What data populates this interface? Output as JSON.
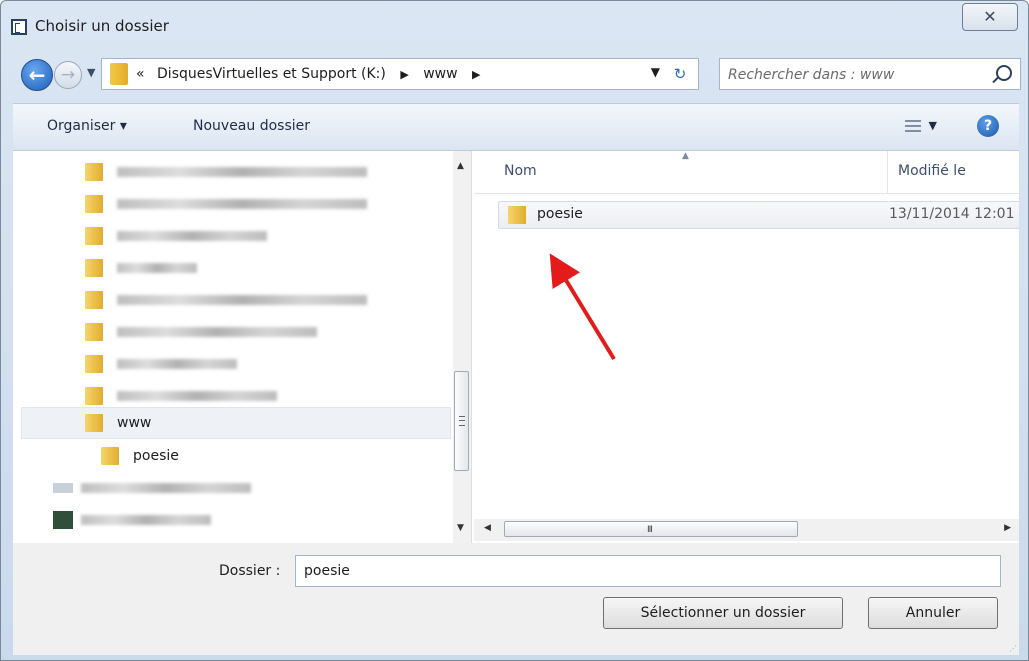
{
  "window": {
    "title": "Choisir un dossier",
    "close_symbol": "✕"
  },
  "address": {
    "chevron": "«",
    "crumbs": [
      "DisquesVirtuelles et Support (K:)",
      "www"
    ]
  },
  "search": {
    "placeholder": "Rechercher dans : www"
  },
  "toolbar": {
    "organise_label": "Organiser ▾",
    "new_folder_label": "Nouveau dossier"
  },
  "tree": {
    "selected_label": "www",
    "child_label": "poesie"
  },
  "file_list": {
    "columns": [
      "Nom",
      "Modifié le"
    ],
    "rows": [
      {
        "name": "poesie",
        "modified": "13/11/2014 12:01"
      }
    ]
  },
  "scroll": {
    "h_grip": "III"
  },
  "bottom": {
    "folder_label": "Dossier :",
    "folder_value": "poesie",
    "select_button": "Sélectionner un dossier",
    "cancel_button": "Annuler"
  },
  "colors": {
    "annotation_arrow": "#e31b1b",
    "selection_bg": "#eef1f6"
  }
}
